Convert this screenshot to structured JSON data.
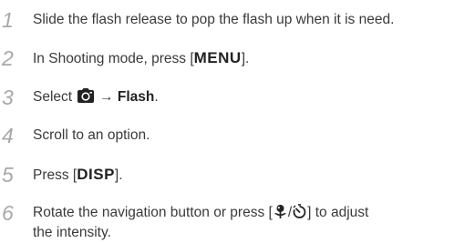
{
  "steps": [
    {
      "number": "1",
      "text": "Slide the flash release to pop the flash up when it is need."
    },
    {
      "number": "2",
      "pre": "In Shooting mode, press [",
      "key": "MENU",
      "post": "]."
    },
    {
      "number": "3",
      "pre": "Select",
      "icon": "camera-icon",
      "arrow": "→",
      "bold": "Flash",
      "post": "."
    },
    {
      "number": "4",
      "text": "Scroll to an option."
    },
    {
      "number": "5",
      "pre": "Press [",
      "key": "DISP",
      "post": "]."
    },
    {
      "number": "6",
      "pre": "Rotate the navigation button or press [",
      "icon_a": "macro-flower-icon",
      "sep": "/",
      "icon_b": "timer-icon",
      "post": "] to adjust",
      "line2": "the intensity."
    }
  ],
  "colors": {
    "number": "#a8a8a8",
    "text": "#3a3a3a",
    "icon": "#222222"
  }
}
